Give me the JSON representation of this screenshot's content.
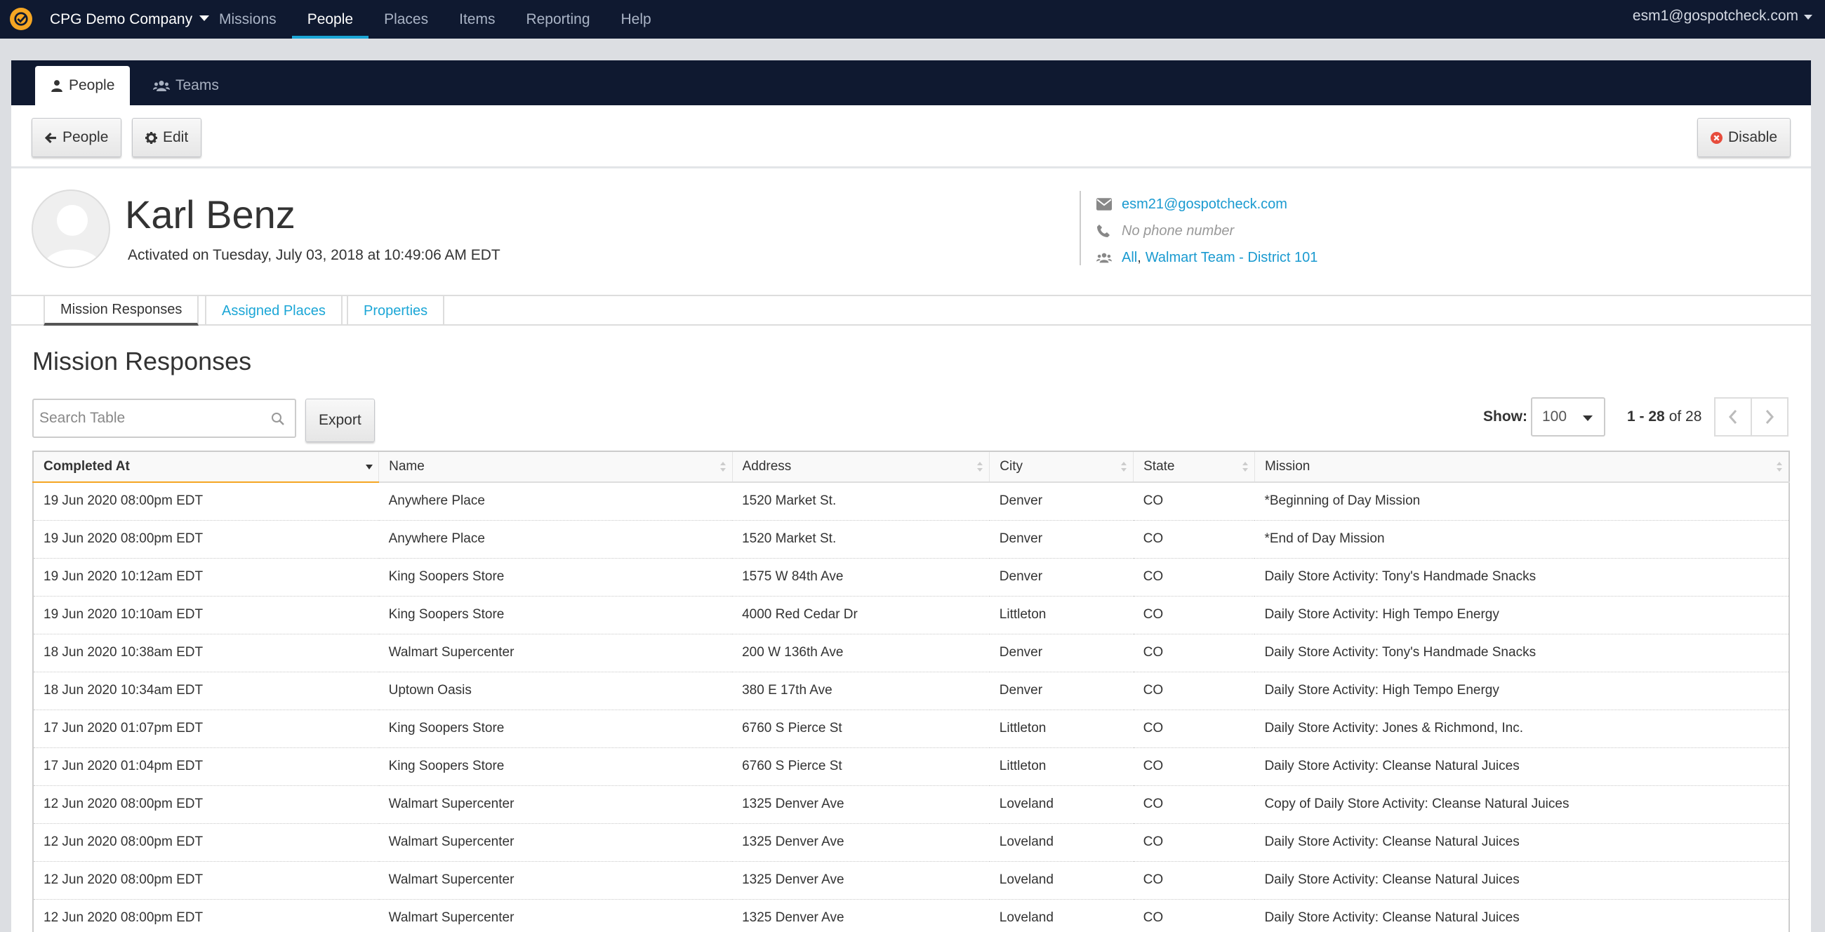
{
  "nav": {
    "company": "CPG Demo Company",
    "links": [
      "Missions",
      "People",
      "Places",
      "Items",
      "Reporting",
      "Help"
    ],
    "active": "People",
    "user_email": "esm1@gospotcheck.com"
  },
  "card_tabs": {
    "people": "People",
    "teams": "Teams"
  },
  "toolbar": {
    "back_label": "People",
    "edit_label": "Edit",
    "disable_label": "Disable"
  },
  "profile": {
    "name": "Karl Benz",
    "activated": "Activated on Tuesday, July 03, 2018 at 10:49:06 AM EDT",
    "email": "esm21@gospotcheck.com",
    "phone": "No phone number",
    "team_all": "All",
    "team_sep": ",",
    "team_name": "Walmart Team - District 101"
  },
  "subtabs": [
    "Mission Responses",
    "Assigned Places",
    "Properties"
  ],
  "section_title": "Mission Responses",
  "search": {
    "placeholder": "Search Table"
  },
  "export_label": "Export",
  "pagination": {
    "show_label": "Show:",
    "page_size": "100",
    "range": "1 - 28",
    "of_label": "of 28"
  },
  "table": {
    "columns": [
      "Completed At",
      "Name",
      "Address",
      "City",
      "State",
      "Mission"
    ],
    "rows": [
      [
        "19 Jun 2020 08:00pm EDT",
        "Anywhere Place",
        "1520 Market St.",
        "Denver",
        "CO",
        "*Beginning of Day Mission"
      ],
      [
        "19 Jun 2020 08:00pm EDT",
        "Anywhere Place",
        "1520 Market St.",
        "Denver",
        "CO",
        "*End of Day Mission"
      ],
      [
        "19 Jun 2020 10:12am EDT",
        "King Soopers Store",
        "1575 W 84th Ave",
        "Denver",
        "CO",
        "Daily Store Activity: Tony's Handmade Snacks"
      ],
      [
        "19 Jun 2020 10:10am EDT",
        "King Soopers Store",
        "4000 Red Cedar Dr",
        "Littleton",
        "CO",
        "Daily Store Activity: High Tempo Energy"
      ],
      [
        "18 Jun 2020 10:38am EDT",
        "Walmart Supercenter",
        "200 W 136th Ave",
        "Denver",
        "CO",
        "Daily Store Activity: Tony's Handmade Snacks"
      ],
      [
        "18 Jun 2020 10:34am EDT",
        "Uptown Oasis",
        "380 E 17th Ave",
        "Denver",
        "CO",
        "Daily Store Activity: High Tempo Energy"
      ],
      [
        "17 Jun 2020 01:07pm EDT",
        "King Soopers Store",
        "6760 S Pierce St",
        "Littleton",
        "CO",
        "Daily Store Activity: Jones & Richmond, Inc."
      ],
      [
        "17 Jun 2020 01:04pm EDT",
        "King Soopers Store",
        "6760 S Pierce St",
        "Littleton",
        "CO",
        "Daily Store Activity: Cleanse Natural Juices"
      ],
      [
        "12 Jun 2020 08:00pm EDT",
        "Walmart Supercenter",
        "1325 Denver Ave",
        "Loveland",
        "CO",
        "Copy of Daily Store Activity: Cleanse Natural Juices"
      ],
      [
        "12 Jun 2020 08:00pm EDT",
        "Walmart Supercenter",
        "1325 Denver Ave",
        "Loveland",
        "CO",
        "Daily Store Activity: Cleanse Natural Juices"
      ],
      [
        "12 Jun 2020 08:00pm EDT",
        "Walmart Supercenter",
        "1325 Denver Ave",
        "Loveland",
        "CO",
        "Daily Store Activity: Cleanse Natural Juices"
      ],
      [
        "12 Jun 2020 08:00pm EDT",
        "Walmart Supercenter",
        "1325 Denver Ave",
        "Loveland",
        "CO",
        "Daily Store Activity: Cleanse Natural Juices"
      ]
    ]
  },
  "colors": {
    "nav_bg": "#0f1930",
    "accent": "#1ba6d6",
    "link": "#1a9ad0",
    "logo": "#f5a623",
    "disable_icon": "#e74c3c"
  },
  "icons": [
    "logo-check-icon",
    "caret-down-icon",
    "user-icon",
    "users-icon",
    "arrow-left-icon",
    "gear-icon",
    "times-circle-icon",
    "envelope-icon",
    "phone-icon",
    "search-icon",
    "chevron-left-icon",
    "chevron-right-icon",
    "sort-icon"
  ]
}
